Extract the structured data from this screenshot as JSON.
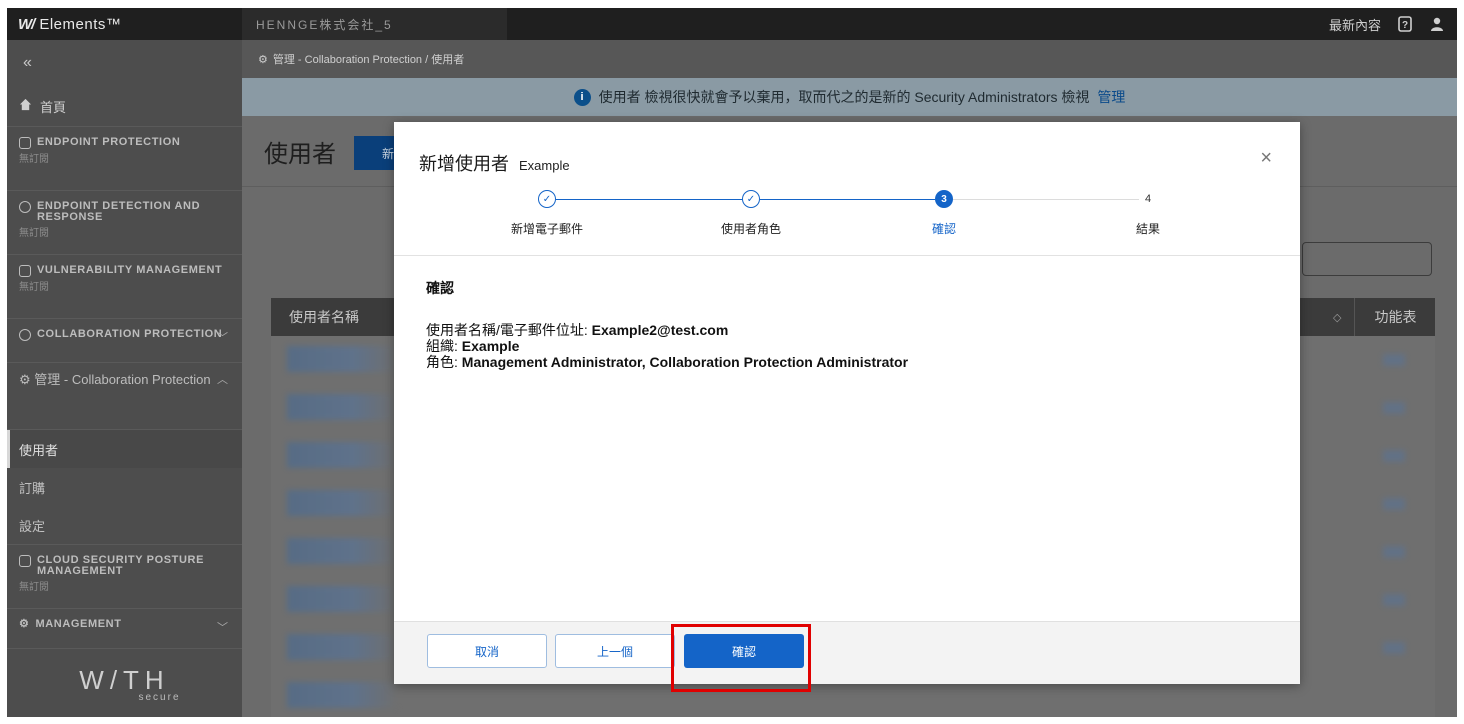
{
  "topbar": {
    "brand_logo": "W/",
    "brand_name": "Elements™",
    "org_name": "HENNGE株式会社_5",
    "whats_new": "最新內容"
  },
  "sidebar": {
    "collapse_icon": "«",
    "home": "首頁",
    "sections": [
      {
        "title": "ENDPOINT PROTECTION",
        "sub": "無訂閱"
      },
      {
        "title": "ENDPOINT DETECTION AND RESPONSE",
        "sub": "無訂閱"
      },
      {
        "title": "VULNERABILITY MANAGEMENT",
        "sub": "無訂閱"
      },
      {
        "title": "COLLABORATION PROTECTION",
        "sub": ""
      }
    ],
    "mgmt_collab": "管理 - Collaboration Protection",
    "items": [
      "使用者",
      "訂購",
      "設定"
    ],
    "cspm": {
      "title": "CLOUD SECURITY POSTURE MANAGEMENT",
      "sub": "無訂閱"
    },
    "management": "MANAGEMENT",
    "footer_logo": "W/TH",
    "footer_sub": "secure"
  },
  "main": {
    "breadcrumb": "管理 - Collaboration Protection / 使用者",
    "banner_text": "使用者 檢視很快就會予以棄用，取而代之的是新的 Security Administrators 檢視",
    "banner_link": "管理",
    "page_title": "使用者",
    "new_button": "新增",
    "table_headers": {
      "name": "使用者名稱",
      "menu": "功能表"
    }
  },
  "modal": {
    "title": "新增使用者",
    "subtitle": "Example",
    "close": "×",
    "steps": [
      {
        "label": "新增電子郵件",
        "state": "done",
        "marker": "✓"
      },
      {
        "label": "使用者角色",
        "state": "done",
        "marker": "✓"
      },
      {
        "label": "確認",
        "state": "current",
        "marker": "3"
      },
      {
        "label": "結果",
        "state": "todo",
        "marker": "4"
      }
    ],
    "body_heading": "確認",
    "fields": [
      {
        "label": "使用者名稱/電子郵件位址:",
        "value": "Example2@test.com"
      },
      {
        "label": "組織:",
        "value": "Example"
      },
      {
        "label": "角色:",
        "value": "Management Administrator, Collaboration Protection Administrator"
      }
    ],
    "buttons": {
      "cancel": "取消",
      "previous": "上一個",
      "confirm": "確認"
    }
  },
  "colors": {
    "accent": "#1464c8",
    "highlight": "#e00000"
  }
}
